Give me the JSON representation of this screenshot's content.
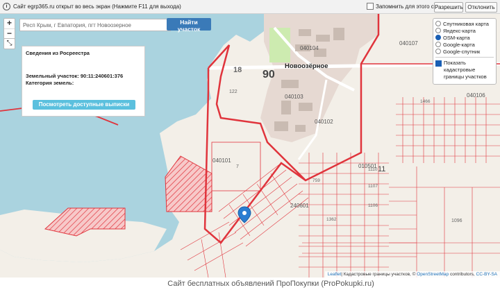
{
  "fullscreen_bar": {
    "message": "Сайт egrp365.ru открыт во весь экран (Нажмите F11 для выхода)",
    "remember_label": "Запомнить для этого сайта",
    "allow_label": "Разрешить",
    "deny_label": "Отклонить"
  },
  "map_controls": {
    "zoom_in": "+",
    "zoom_out": "−",
    "fullscreen": "⤡"
  },
  "search": {
    "value": "Респ Крым, г Евпатория, пгт Новоозерное",
    "button_label": "Найти участок"
  },
  "layers": {
    "options": [
      "Спутниковая карта",
      "Яндекс-карта",
      "OSM-карта",
      "Google-карта",
      "Google-спутник"
    ],
    "selected": "OSM-карта",
    "cadastral_label": "Показать кадастровые границы участков"
  },
  "info_panel": {
    "title": "Сведения из Росреестра",
    "parcel_line": "Земельный участок: 90:11:240601:376",
    "category_line": "Категория земель:",
    "button_label": "Посмотреть доступные выписки"
  },
  "map_labels": {
    "district_18": "18",
    "district_90": "90",
    "settlement": "Новоозёрное",
    "block_040104": "040104",
    "block_040103": "040103",
    "block_040102": "040102",
    "block_040101": "040101",
    "block_010501": "010501",
    "block_11": "11",
    "block_240601": "240601",
    "block_040107": "040107",
    "block_040106": "040106",
    "parcel_122": "122",
    "parcel_7": "7",
    "parcel_1466": "1466",
    "parcel_1096": "1096",
    "parcel_1107": "1107",
    "parcel_1106": "1106",
    "parcel_759": "759",
    "parcel_1362": "1362",
    "parcel_1110": "1110"
  },
  "attribution": {
    "leaflet": "Leaflet",
    "text": "| Кадастровые границы участков, © ",
    "osm": "OpenStreetMap",
    "contributors": " contributors, ",
    "license": "CC-BY-SA"
  },
  "footer": {
    "text": "Сайт бесплатных объявлений ПроПокупки (ProPokupki.ru)"
  },
  "colors": {
    "water": "#aad3df",
    "land": "#f3efe8",
    "parcel_red": "#e0343c",
    "town": "#e6d9d2",
    "accent": "#3a7ab8"
  }
}
